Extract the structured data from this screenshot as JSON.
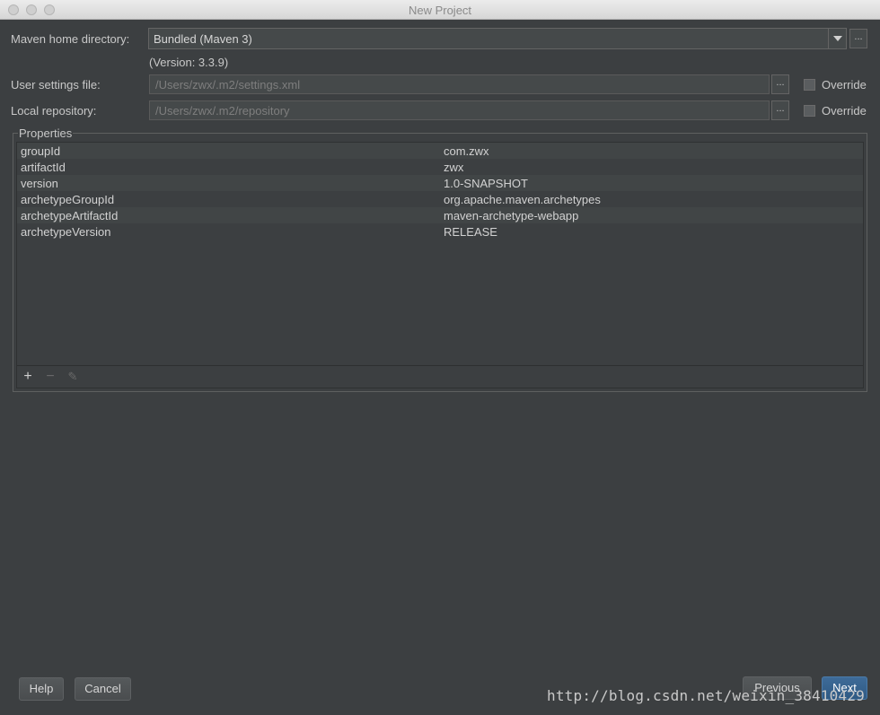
{
  "window": {
    "title": "New Project"
  },
  "maven": {
    "home_label": "Maven home directory:",
    "home_value": "Bundled (Maven 3)",
    "version_text": "(Version: 3.3.9)",
    "browse_label": "..."
  },
  "user_settings": {
    "label": "User settings file:",
    "value": "/Users/zwx/.m2/settings.xml",
    "browse_label": "...",
    "override_label": "Override"
  },
  "local_repo": {
    "label": "Local repository:",
    "value": "/Users/zwx/.m2/repository",
    "browse_label": "...",
    "override_label": "Override"
  },
  "properties": {
    "title": "Properties",
    "rows": [
      {
        "key": "groupId",
        "value": "com.zwx"
      },
      {
        "key": "artifactId",
        "value": "zwx"
      },
      {
        "key": "version",
        "value": "1.0-SNAPSHOT"
      },
      {
        "key": "archetypeGroupId",
        "value": "org.apache.maven.archetypes"
      },
      {
        "key": "archetypeArtifactId",
        "value": "maven-archetype-webapp"
      },
      {
        "key": "archetypeVersion",
        "value": "RELEASE"
      }
    ],
    "toolbar": {
      "add": "+",
      "remove": "−",
      "edit": "✎"
    }
  },
  "buttons": {
    "help": "Help",
    "cancel": "Cancel",
    "previous": "Previous",
    "next": "Next"
  },
  "watermark": "http://blog.csdn.net/weixin_38410429"
}
